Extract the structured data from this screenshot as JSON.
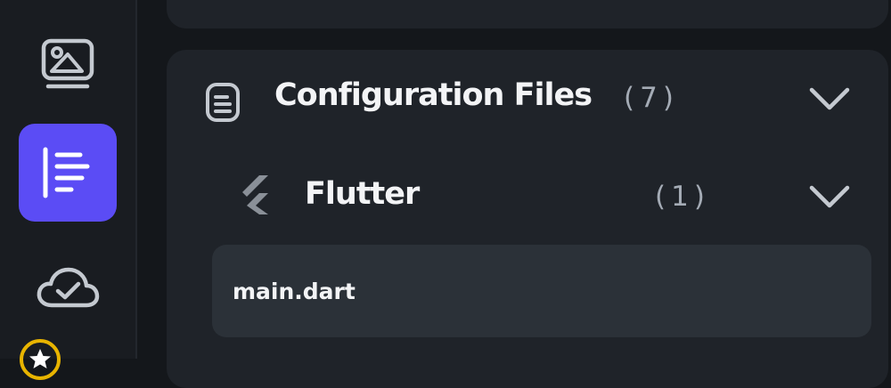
{
  "rail": {
    "items": [
      {
        "icon": "image-gallery-icon",
        "active": false
      },
      {
        "icon": "document-list-icon",
        "active": true
      },
      {
        "icon": "cloud-check-icon",
        "active": false
      },
      {
        "icon": "star-badge-icon",
        "active": false
      }
    ],
    "accent_color": "#5b4cf5"
  },
  "section": {
    "icon": "file-document-icon",
    "title": "Configuration Files",
    "count": "(7)",
    "expanded": true
  },
  "subsection": {
    "icon": "flutter-logo-icon",
    "title": "Flutter",
    "count": "(1)",
    "expanded": true
  },
  "files": [
    {
      "name": "main.dart"
    }
  ]
}
